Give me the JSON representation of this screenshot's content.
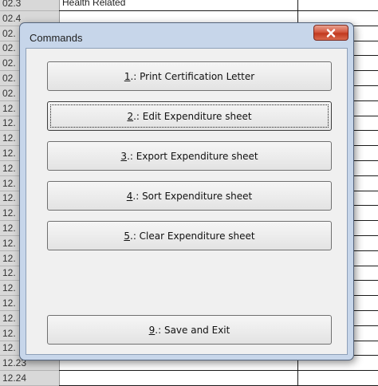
{
  "sheet": {
    "rows": [
      {
        "header": "02.3",
        "cell": "Health Related"
      },
      {
        "header": "02.4",
        "cell": ""
      },
      {
        "header": "02.",
        "cell": ""
      },
      {
        "header": "02.",
        "cell": ""
      },
      {
        "header": "02.",
        "cell": ""
      },
      {
        "header": "02.",
        "cell": ""
      },
      {
        "header": "02.",
        "cell": ""
      },
      {
        "header": "12.",
        "cell": ""
      },
      {
        "header": "12.",
        "cell": ""
      },
      {
        "header": "12.",
        "cell": ""
      },
      {
        "header": "12.",
        "cell": ""
      },
      {
        "header": "12.",
        "cell": ""
      },
      {
        "header": "12.",
        "cell": ""
      },
      {
        "header": "12.",
        "cell": ""
      },
      {
        "header": "12.",
        "cell": ""
      },
      {
        "header": "12.",
        "cell": ""
      },
      {
        "header": "12.",
        "cell": ""
      },
      {
        "header": "12.",
        "cell": ""
      },
      {
        "header": "12.",
        "cell": ""
      },
      {
        "header": "12.",
        "cell": ""
      },
      {
        "header": "12.",
        "cell": ""
      },
      {
        "header": "12.",
        "cell": ""
      },
      {
        "header": "12.",
        "cell": ""
      },
      {
        "header": "12.",
        "cell": ""
      },
      {
        "header": "12.23",
        "cell": ""
      },
      {
        "header": "12.24",
        "cell": ""
      }
    ]
  },
  "dialog": {
    "title": "Commands",
    "close_icon": "close-x-icon",
    "buttons": [
      {
        "key": "1",
        "rest": ".: Print Certification Letter",
        "focused": false
      },
      {
        "key": "2",
        "rest": ".: Edit Expenditure sheet",
        "focused": true
      },
      {
        "key": "3",
        "rest": ".: Export Expenditure sheet",
        "focused": false
      },
      {
        "key": "4",
        "rest": ".: Sort Expenditure sheet",
        "focused": false
      },
      {
        "key": "5",
        "rest": ".: Clear Expenditure sheet",
        "focused": false
      },
      {
        "key": "9",
        "rest": ".: Save and Exit",
        "focused": false
      }
    ]
  },
  "colors": {
    "dialog_frame": "#c7d6ea",
    "client_bg": "#f0f0f0",
    "close_button": "#c2391f"
  }
}
